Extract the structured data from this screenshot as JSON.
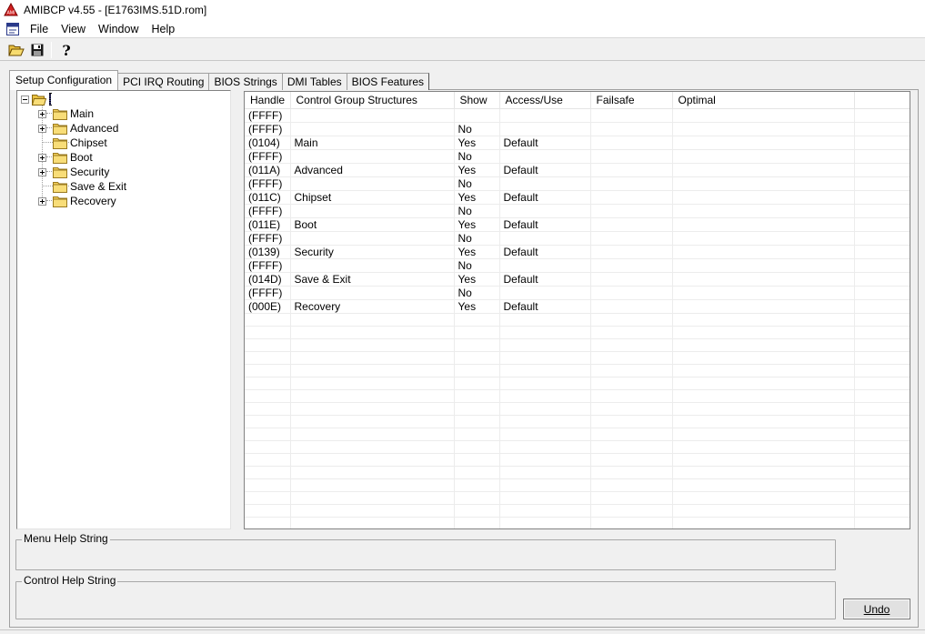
{
  "window": {
    "title": "AMIBCP v4.55 - [E1763IMS.51D.rom]"
  },
  "menu": {
    "items": [
      {
        "label": "File"
      },
      {
        "label": "View"
      },
      {
        "label": "Window"
      },
      {
        "label": "Help"
      }
    ]
  },
  "toolbar": {
    "open_icon": "open-folder-icon",
    "save_icon": "floppy-disk-icon",
    "help_icon": "question-mark-icon"
  },
  "tabs": [
    {
      "label": "Setup Configuration",
      "active": true
    },
    {
      "label": "PCI IRQ Routing",
      "active": false
    },
    {
      "label": "BIOS Strings",
      "active": false
    },
    {
      "label": "DMI Tables",
      "active": false
    },
    {
      "label": "BIOS Features",
      "active": false
    }
  ],
  "tree": {
    "nodes": [
      {
        "label": "Main",
        "expandable": true
      },
      {
        "label": "Advanced",
        "expandable": true
      },
      {
        "label": "Chipset",
        "expandable": false
      },
      {
        "label": "Boot",
        "expandable": true
      },
      {
        "label": "Security",
        "expandable": true
      },
      {
        "label": "Save & Exit",
        "expandable": false
      },
      {
        "label": "Recovery",
        "expandable": true
      }
    ]
  },
  "grid": {
    "columns": [
      "Handle",
      "Control Group Structures",
      "Show",
      "Access/Use",
      "Failsafe",
      "Optimal"
    ],
    "rows": [
      [
        "(FFFF)",
        "",
        "",
        "",
        "",
        ""
      ],
      [
        "(FFFF)",
        "",
        "No",
        "",
        "",
        ""
      ],
      [
        "(0104)",
        "Main",
        "Yes",
        "Default",
        "",
        ""
      ],
      [
        "(FFFF)",
        "",
        "No",
        "",
        "",
        ""
      ],
      [
        "(011A)",
        "Advanced",
        "Yes",
        "Default",
        "",
        ""
      ],
      [
        "(FFFF)",
        "",
        "No",
        "",
        "",
        ""
      ],
      [
        "(011C)",
        "Chipset",
        "Yes",
        "Default",
        "",
        ""
      ],
      [
        "(FFFF)",
        "",
        "No",
        "",
        "",
        ""
      ],
      [
        "(011E)",
        "Boot",
        "Yes",
        "Default",
        "",
        ""
      ],
      [
        "(FFFF)",
        "",
        "No",
        "",
        "",
        ""
      ],
      [
        "(0139)",
        "Security",
        "Yes",
        "Default",
        "",
        ""
      ],
      [
        "(FFFF)",
        "",
        "No",
        "",
        "",
        ""
      ],
      [
        "(014D)",
        "Save & Exit",
        "Yes",
        "Default",
        "",
        ""
      ],
      [
        "(FFFF)",
        "",
        "No",
        "",
        "",
        ""
      ],
      [
        "(000E)",
        "Recovery",
        "Yes",
        "Default",
        "",
        ""
      ]
    ]
  },
  "help": {
    "menu_help_label": "Menu Help String",
    "control_help_label": "Control Help String"
  },
  "buttons": {
    "undo_label": "Undo"
  }
}
